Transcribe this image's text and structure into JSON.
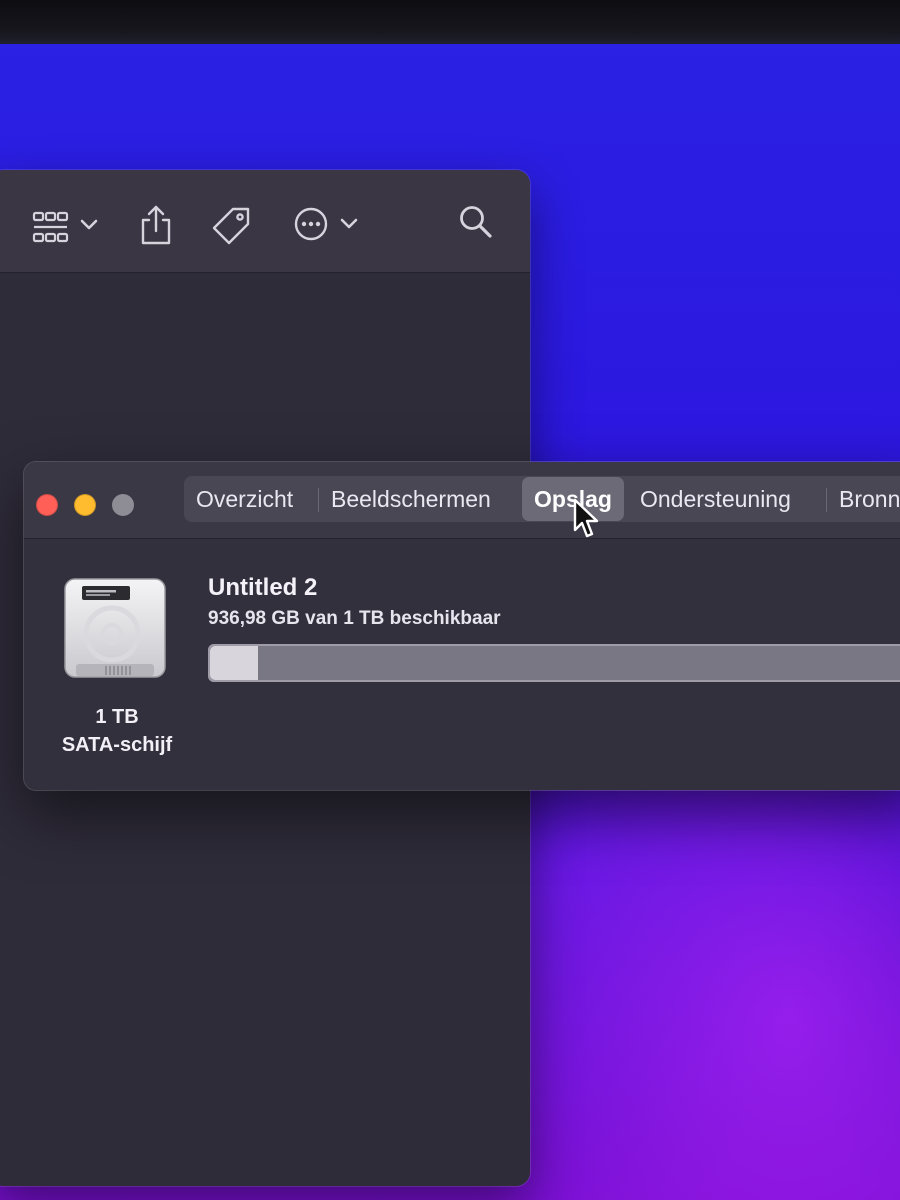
{
  "finder_toolbar": {
    "icons": [
      "grid-view-icon",
      "chevron-down-icon",
      "share-icon",
      "tag-icon",
      "more-actions-icon",
      "chevron-down-icon",
      "search-icon"
    ]
  },
  "about_window": {
    "tabs": [
      {
        "label": "Overzicht",
        "active": false
      },
      {
        "label": "Beeldschermen",
        "active": false
      },
      {
        "label": "Opslag",
        "active": true
      },
      {
        "label": "Ondersteuning",
        "active": false
      },
      {
        "label": "Bronn",
        "active": false
      }
    ],
    "disk": {
      "size_label": "1 TB",
      "type_label": "SATA-schijf"
    },
    "volume": {
      "name": "Untitled 2",
      "availability": "936,98 GB van 1 TB beschikbaar",
      "used_fraction": 0.063
    }
  },
  "colors": {
    "close": "#ff5f57",
    "minimize": "#febc2e",
    "zoom": "#8e8c95",
    "desktop_blue": "#2a22e4",
    "desktop_purple": "#7a10d4"
  }
}
